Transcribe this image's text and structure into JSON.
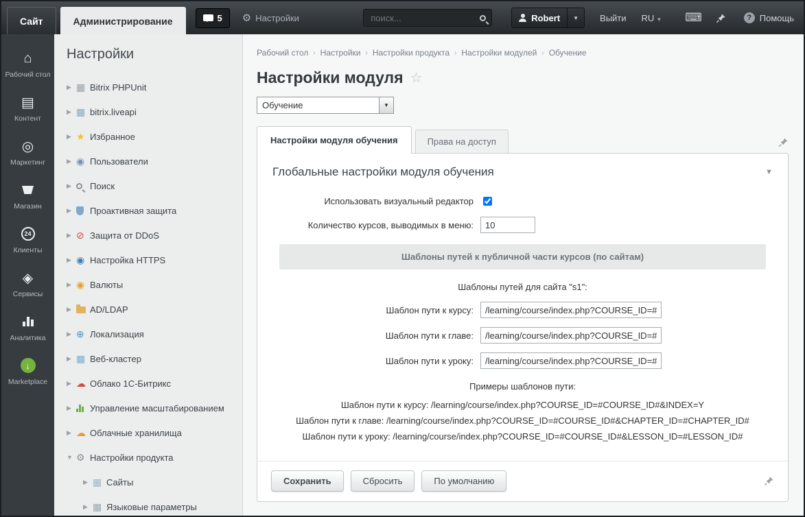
{
  "topbar": {
    "site_tab": "Сайт",
    "admin_tab": "Администрирование",
    "notifications_count": "5",
    "settings_label": "Настройки",
    "search_placeholder": "поиск...",
    "user_name": "Robert",
    "logout_label": "Выйти",
    "lang_label": "RU",
    "help_label": "Помощь"
  },
  "rail": {
    "items": [
      {
        "label": "Рабочий стол",
        "icon": "desktop-icon"
      },
      {
        "label": "Контент",
        "icon": "content-icon"
      },
      {
        "label": "Маркетинг",
        "icon": "marketing-icon"
      },
      {
        "label": "Магазин",
        "icon": "shop-icon"
      },
      {
        "label": "Клиенты",
        "icon": "clients-icon"
      },
      {
        "label": "Сервисы",
        "icon": "services-icon"
      },
      {
        "label": "Аналитика",
        "icon": "analytics-icon"
      },
      {
        "label": "Marketplace",
        "icon": "marketplace-icon"
      }
    ]
  },
  "sidebar": {
    "title": "Настройки",
    "items": [
      {
        "label": "Bitrix PHPUnit",
        "icon": "module-icon"
      },
      {
        "label": "bitrix.liveapi",
        "icon": "api-icon"
      },
      {
        "label": "Избранное",
        "icon": "star-icon"
      },
      {
        "label": "Пользователи",
        "icon": "users-icon"
      },
      {
        "label": "Поиск",
        "icon": "search-icon"
      },
      {
        "label": "Проактивная защита",
        "icon": "shield-icon"
      },
      {
        "label": "Защита от DDoS",
        "icon": "ddos-icon"
      },
      {
        "label": "Настройка HTTPS",
        "icon": "https-icon"
      },
      {
        "label": "Валюты",
        "icon": "currency-icon"
      },
      {
        "label": "AD/LDAP",
        "icon": "folder-icon"
      },
      {
        "label": "Локализация",
        "icon": "globe-icon"
      },
      {
        "label": "Веб-кластер",
        "icon": "cluster-icon"
      },
      {
        "label": "Облако 1С-Битрикс",
        "icon": "cloud-red-icon"
      },
      {
        "label": "Управление масштабированием",
        "icon": "scale-icon"
      },
      {
        "label": "Облачные хранилища",
        "icon": "cloud-orange-icon"
      },
      {
        "label": "Настройки продукта",
        "icon": "gear-icon",
        "expanded": true
      },
      {
        "label": "Сайты",
        "icon": "sites-icon",
        "child": true
      },
      {
        "label": "Языковые параметры",
        "icon": "lang-icon",
        "child": true
      }
    ]
  },
  "breadcrumb": [
    "Рабочий стол",
    "Настройки",
    "Настройки продукта",
    "Настройки модулей",
    "Обучение"
  ],
  "page": {
    "title": "Настройки модуля",
    "module_select_value": "Обучение",
    "tabs": [
      {
        "label": "Настройки модуля обучения",
        "active": true
      },
      {
        "label": "Права на доступ",
        "active": false
      }
    ],
    "section_title": "Глобальные настройки модуля обучения",
    "form": {
      "visual_editor_label": "Использовать визуальный редактор",
      "visual_editor_checked": true,
      "course_count_label": "Количество курсов, выводимых в меню:",
      "course_count_value": "10",
      "templates_header": "Шаблоны путей к публичной части курсов (по сайтам)",
      "site_templates_label": "Шаблоны путей для сайта \"s1\":",
      "path_rows": [
        {
          "label": "Шаблон пути к курсу:",
          "value": "/learning/course/index.php?COURSE_ID=#CO"
        },
        {
          "label": "Шаблон пути к главе:",
          "value": "/learning/course/index.php?COURSE_ID=#CO"
        },
        {
          "label": "Шаблон пути к уроку:",
          "value": "/learning/course/index.php?COURSE_ID=#CO"
        }
      ],
      "examples_title": "Примеры шаблонов пути:",
      "examples": [
        "Шаблон пути к курсу: /learning/course/index.php?COURSE_ID=#COURSE_ID#&INDEX=Y",
        "Шаблон пути к главе: /learning/course/index.php?COURSE_ID=#COURSE_ID#&CHAPTER_ID=#CHAPTER_ID#",
        "Шаблон пути к уроку: /learning/course/index.php?COURSE_ID=#COURSE_ID#&LESSON_ID=#LESSON_ID#"
      ]
    },
    "buttons": [
      {
        "label": "Сохранить",
        "primary": true
      },
      {
        "label": "Сбросить",
        "primary": false
      },
      {
        "label": "По умолчанию",
        "primary": false
      }
    ]
  },
  "colors": {
    "topbar_dark": "#2b2f33",
    "sidebar_bg": "#eceeee",
    "accent_blue": "#4d8fc4",
    "card_border": "#c9cdcf"
  }
}
